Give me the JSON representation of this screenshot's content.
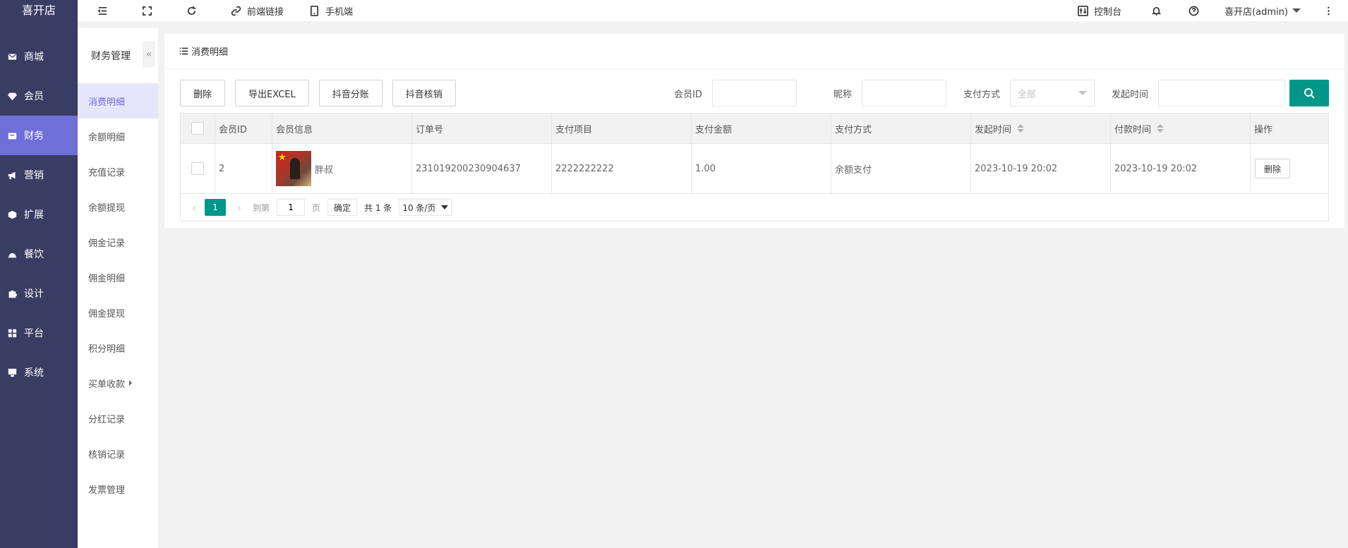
{
  "app": {
    "logo": "喜开店"
  },
  "sidebar": {
    "items": [
      {
        "label": "商城",
        "icon": "mail-icon"
      },
      {
        "label": "会员",
        "icon": "gem-icon"
      },
      {
        "label": "财务",
        "icon": "wallet-icon",
        "active": true
      },
      {
        "label": "营销",
        "icon": "megaphone-icon"
      },
      {
        "label": "扩展",
        "icon": "cube-icon"
      },
      {
        "label": "餐饮",
        "icon": "cloche-icon"
      },
      {
        "label": "设计",
        "icon": "puzzle-icon"
      },
      {
        "label": "平台",
        "icon": "grid-icon"
      },
      {
        "label": "系统",
        "icon": "monitor-icon"
      }
    ]
  },
  "subnav": {
    "title": "财务管理",
    "collapse": "«",
    "items": [
      {
        "label": "消费明细",
        "active": true
      },
      {
        "label": "余额明细"
      },
      {
        "label": "充值记录"
      },
      {
        "label": "余额提现"
      },
      {
        "label": "佣金记录"
      },
      {
        "label": "佣金明细"
      },
      {
        "label": "佣金提现"
      },
      {
        "label": "积分明细"
      },
      {
        "label": "买单收款",
        "submenu": true
      },
      {
        "label": "分红记录"
      },
      {
        "label": "核销记录"
      },
      {
        "label": "发票管理"
      }
    ]
  },
  "header": {
    "front_link": "前端链接",
    "mobile": "手机端",
    "console": "控制台",
    "user": "喜开店(admin)"
  },
  "panel": {
    "title": "消费明细",
    "buttons": {
      "delete": "删除",
      "export": "导出EXCEL",
      "split": "抖音分账",
      "verify": "抖音核销"
    },
    "filters": {
      "member_id_label": "会员ID",
      "nickname_label": "昵称",
      "pay_method_label": "支付方式",
      "pay_method_value": "全部",
      "start_time_label": "发起时间"
    }
  },
  "table": {
    "headers": [
      "会员ID",
      "会员信息",
      "订单号",
      "支付项目",
      "支付金额",
      "支付方式",
      "发起时间",
      "付款时间",
      "操作"
    ],
    "rows": [
      {
        "member_id": "2",
        "member_name": "胖叔",
        "order_no": "231019200230904637",
        "item": "2222222222",
        "amount": "1.00",
        "method": "余额支付",
        "created": "2023-10-19 20:02",
        "paid": "2023-10-19 20:02",
        "action": "删除"
      }
    ]
  },
  "pager": {
    "current": "1",
    "goto_label": "到第",
    "goto_value": "1",
    "page_unit": "页",
    "confirm": "确定",
    "total": "共 1 条",
    "per_page": "10 条/页"
  },
  "colors": {
    "accent": "#009688",
    "sidebar": "#393d63",
    "active": "#6f6fd9"
  }
}
